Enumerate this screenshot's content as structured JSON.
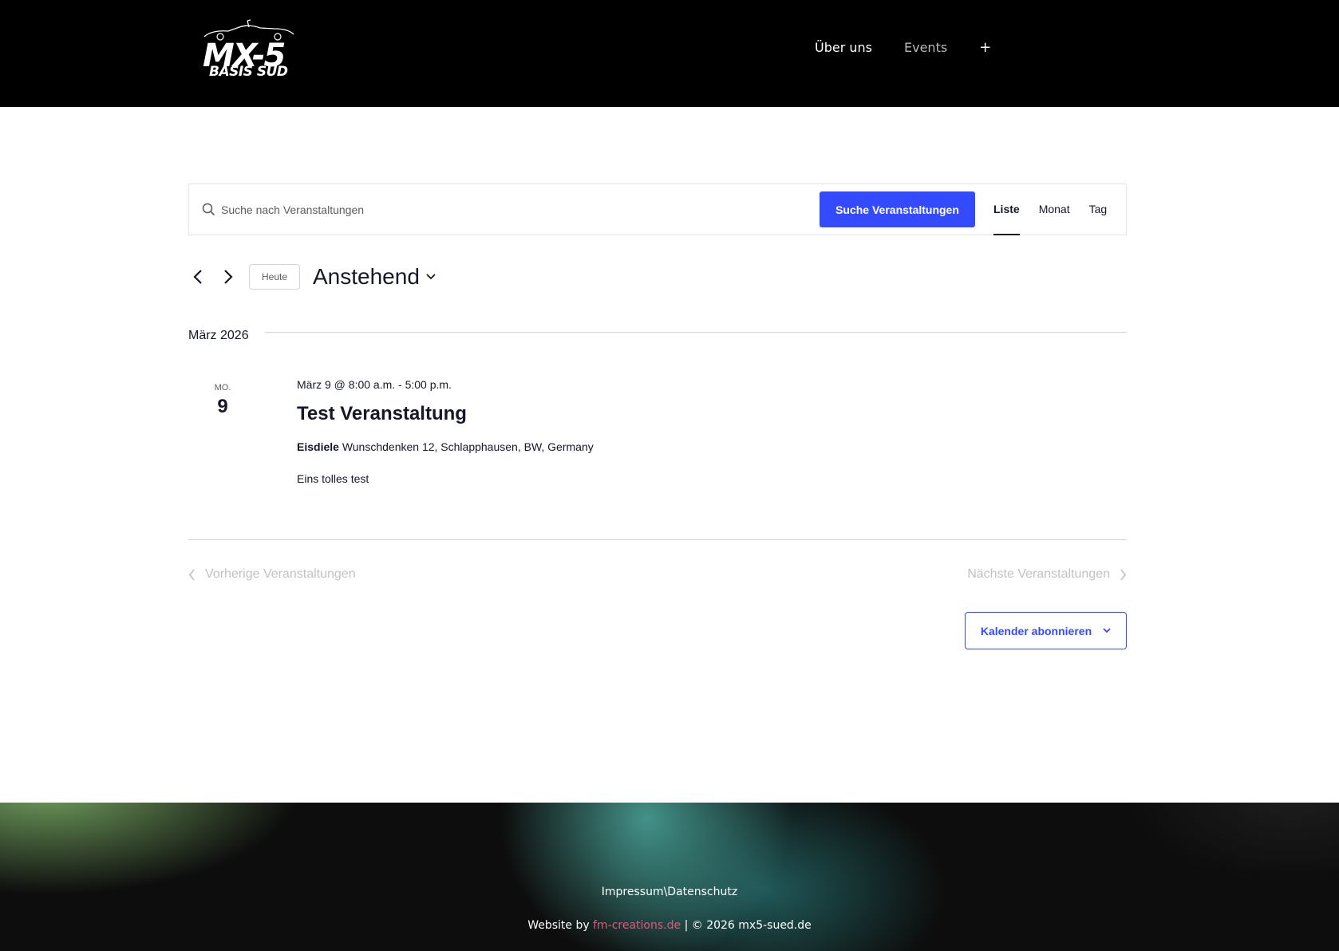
{
  "header": {
    "logo_main": "MX-5",
    "logo_sub": "BASIS SÜD",
    "nav": {
      "about": "Über uns",
      "events": "Events",
      "plus": "+"
    }
  },
  "search": {
    "placeholder": "Suche nach Veranstaltungen",
    "button": "Suche Veranstaltungen",
    "views": [
      "Liste",
      "Monat",
      "Tag"
    ],
    "active_view": "Liste"
  },
  "date_nav": {
    "today": "Heute",
    "range": "Anstehend"
  },
  "month_label": "März 2026",
  "event": {
    "weekday": "MO.",
    "daynum": "9",
    "datetime": "März 9 @ 8:00 a.m. - 5:00 p.m.",
    "title": "Test Veranstaltung",
    "venue_name": "Eisdiele",
    "venue_address": "Wunschdenken 12, Schlapphausen, BW, Germany",
    "description": "Eins tolles test"
  },
  "pagination": {
    "prev": "Vorherige Veranstaltungen",
    "next": "Nächste Veranstaltungen"
  },
  "subscribe": "Kalender abonnieren",
  "footer": {
    "links": "Impressum\\Datenschutz",
    "credit_prefix": "Website by ",
    "credit_link": "fm-creations.de",
    "credit_suffix": " | © 2026 mx5-sued.de"
  },
  "colors": {
    "accent": "#334aff",
    "header_bg": "#000000",
    "credit_link": "#e0587c"
  }
}
